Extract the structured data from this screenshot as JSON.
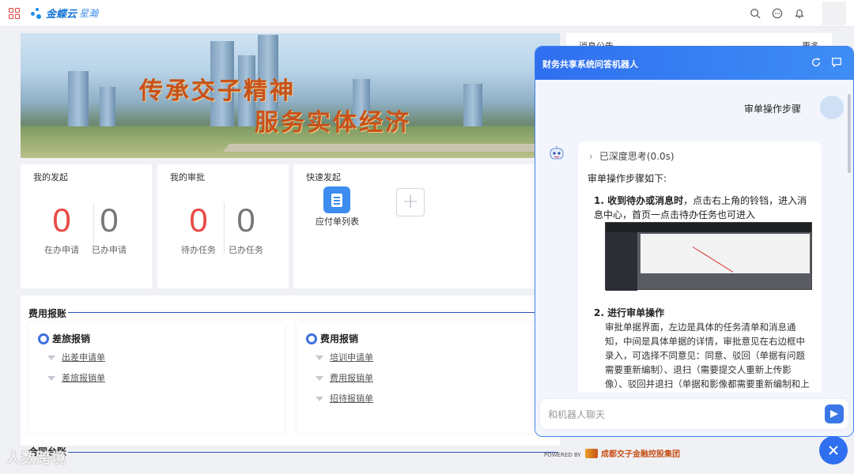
{
  "topbar": {
    "brand_name": "金蝶云",
    "brand_sub": "星瀚"
  },
  "banner": {
    "slogan_line1": "传承交子精神",
    "slogan_line2": "服务实体经济"
  },
  "my_initiated": {
    "title": "我的发起",
    "stats": [
      {
        "value": "0",
        "label": "在办申请"
      },
      {
        "value": "0",
        "label": "已办申请"
      }
    ]
  },
  "my_approval": {
    "title": "我的审批",
    "stats": [
      {
        "value": "0",
        "label": "待办任务"
      },
      {
        "value": "0",
        "label": "已办任务"
      }
    ]
  },
  "quick_start": {
    "title": "快速发起",
    "item_label": "应付单列表",
    "add_label": "+"
  },
  "notice": {
    "title": "消息公告",
    "more": "更多"
  },
  "expense_section": {
    "title": "费用报账",
    "groups": [
      {
        "title": "差旅报销",
        "links": [
          "出差申请单",
          "差旅报销单"
        ]
      },
      {
        "title": "费用报销",
        "links": [
          "培训申请单",
          "费用报销单",
          "招待报销单"
        ]
      }
    ]
  },
  "contract_section": {
    "title": "合同台账"
  },
  "watermark": "人数跨境",
  "chat": {
    "title": "财务共享系统问答机器人",
    "user_message": "审单操作步骤",
    "thinking": "已深度思考(0.0s)",
    "intro": "审单操作步骤如下:",
    "steps": [
      {
        "title": "1. 收到待办或消息时",
        "text": "，点击右上角的铃铛，进入消息中心，首页一点击待办任务也可进入"
      },
      {
        "title": "2. 进行审单操作",
        "text": "审批单据界面，左边是具体的任务清单和消息通知，中间是具体单据的详情，审批意见在右边框中录入，可选择不同意见：同意、驳回（单据有问题需要重新编制）、退扫（需要提交人重新上传影像）、驳回并退扫（单据和影像都需要重新编制和上传），同意即进入下一个节点。审批记录可查看该单据的所有审批"
      }
    ],
    "input_placeholder": "和机器人聊天"
  },
  "footer": {
    "powered_by": "POWERED BY",
    "group_name": "成都交子金融控股集团"
  },
  "colors": {
    "accent": "#2f6ff0",
    "red_count": "#e94a45",
    "section_line": "#2d4fb8"
  }
}
